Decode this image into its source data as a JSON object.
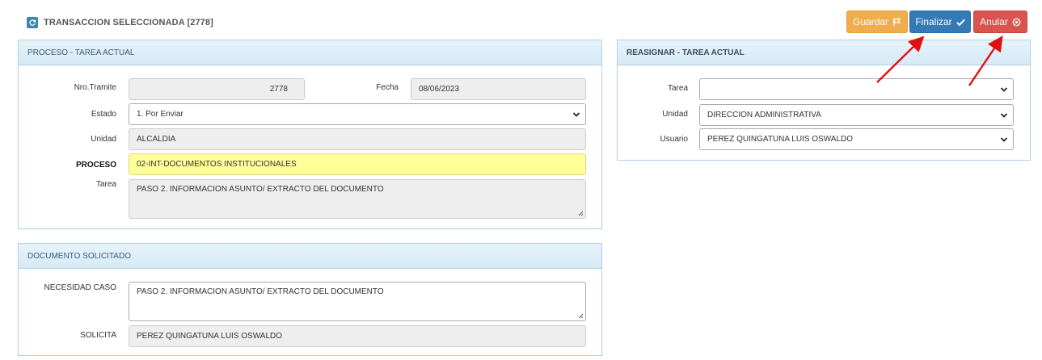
{
  "header": {
    "title": "TRANSACCION SELECCIONADA [2778]"
  },
  "toolbar": {
    "save_label": "Guardar",
    "finish_label": "Finalizar",
    "cancel_label": "Anular"
  },
  "proceso_panel": {
    "title": "PROCESO - TAREA ACTUAL",
    "nro_tramite_label": "Nro.Tramite",
    "nro_tramite_value": "2778",
    "fecha_label": "Fecha",
    "fecha_value": "08/06/2023",
    "estado_label": "Estado",
    "estado_value": "1. Por Enviar",
    "unidad_label": "Unidad",
    "unidad_value": "ALCALDIA",
    "proceso_label": "PROCESO",
    "proceso_value": "02-INT-DOCUMENTOS INSTITUCIONALES",
    "tarea_label": "Tarea",
    "tarea_value": "PASO 2. INFORMACION ASUNTO/ EXTRACTO DEL DOCUMENTO"
  },
  "documento_panel": {
    "title": "DOCUMENTO SOLICITADO",
    "necesidad_label": "NECESIDAD CASO",
    "necesidad_value": "PASO 2. INFORMACION ASUNTO/ EXTRACTO DEL DOCUMENTO",
    "solicita_label": "SOLICITA",
    "solicita_value": "PEREZ QUINGATUNA LUIS OSWALDO"
  },
  "reasignar_panel": {
    "title": "REASIGNAR - TAREA ACTUAL",
    "tarea_label": "Tarea",
    "tarea_value": "",
    "unidad_label": "Unidad",
    "unidad_value": "DIRECCION ADMINISTRATIVA",
    "usuario_label": "Usuario",
    "usuario_value": "PEREZ QUINGATUNA LUIS OSWALDO"
  },
  "colors": {
    "save": "#f0ad4e",
    "finish": "#337ab7",
    "cancel": "#d9534f",
    "panel_border": "#aed0ea",
    "highlight": "#ffff99",
    "annotation_arrow": "#e01010"
  },
  "icons": [
    "refresh-icon",
    "flag-icon",
    "check-icon",
    "circle-dot-icon",
    "chevron-down-icon",
    "resize-grip-icon"
  ]
}
